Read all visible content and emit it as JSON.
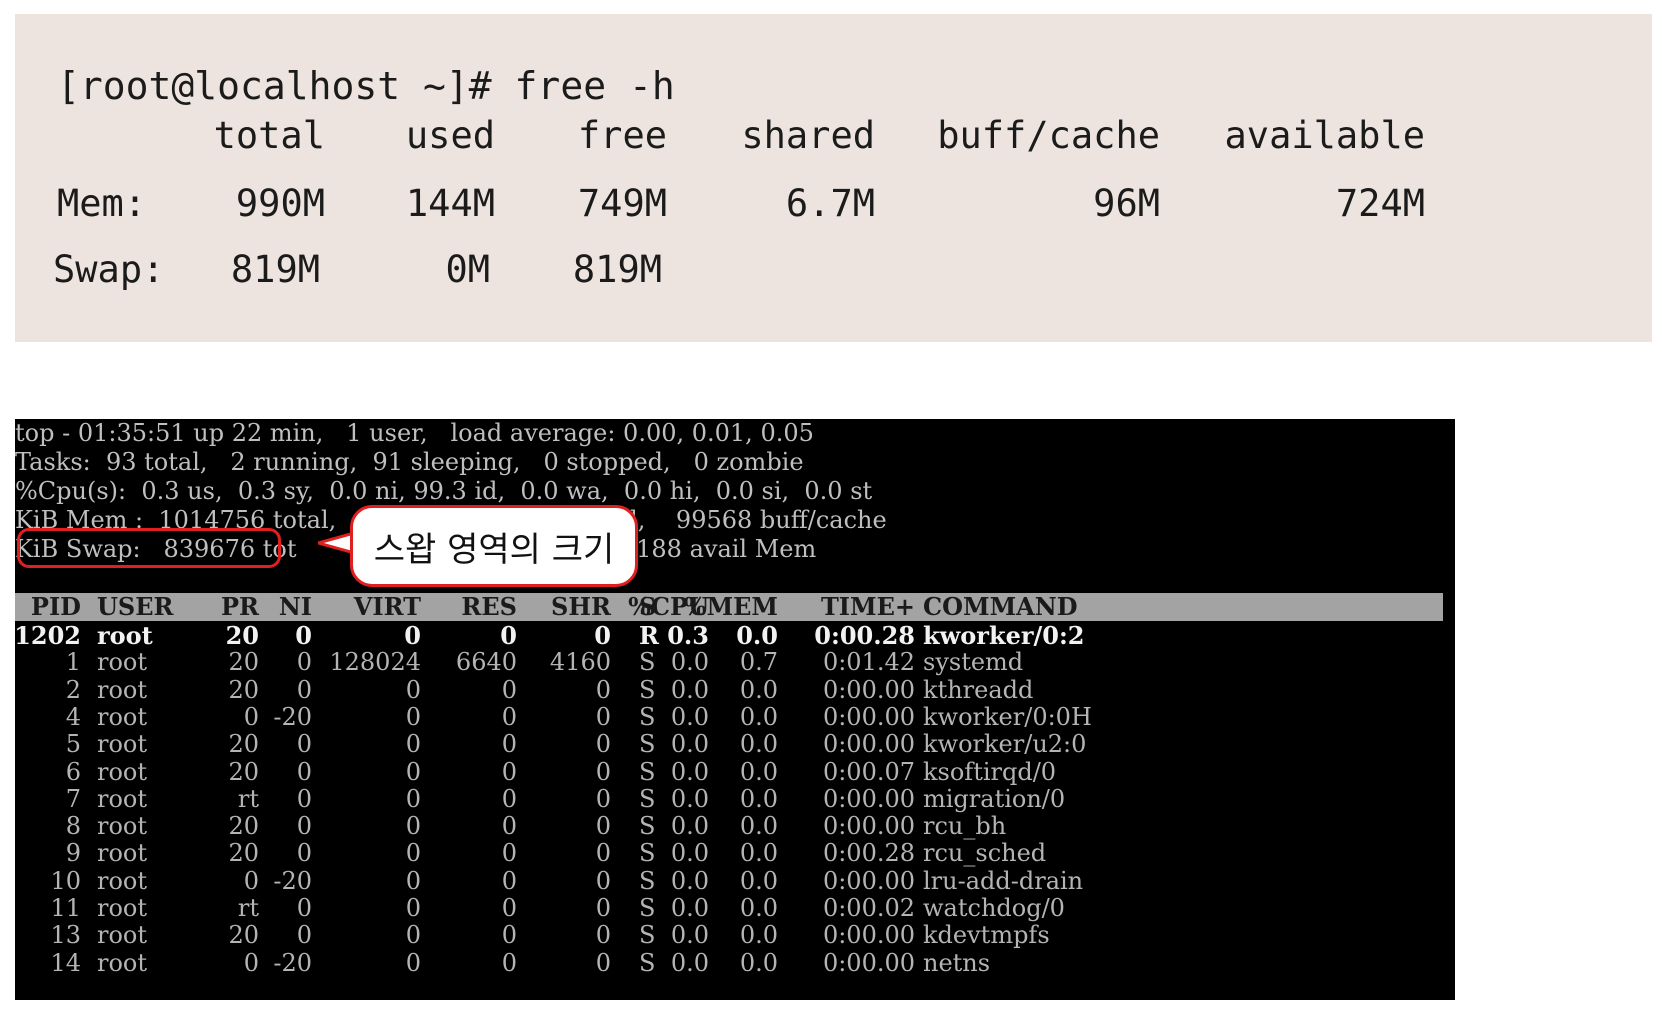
{
  "free": {
    "prompt": "[root@localhost ~]# free -h",
    "headers": [
      "total",
      "used",
      "free",
      "shared",
      "buff/cache",
      "available"
    ],
    "rows": [
      {
        "label": "Mem:",
        "values": [
          "990M",
          "144M",
          "749M",
          "6.7M",
          "96M",
          "724M"
        ]
      },
      {
        "label": "Swap:",
        "values": [
          "819M",
          "0M",
          "819M",
          "",
          "",
          ""
        ]
      }
    ]
  },
  "top": {
    "summary": [
      "top - 01:35:51 up 22 min,   1 user,   load average: 0.00, 0.01, 0.05",
      "Tasks:  93 total,   2 running,  91 sleeping,   0 stopped,   0 zombie",
      "%Cpu(s):  0.3 us,  0.3 sy,  0.0 ni, 99.3 id,  0.0 wa,  0.0 hi,  0.0 si,  0.0 st",
      "KiB Mem :  1014756 total,                   148896 used,    99568 buff/cache",
      "KiB Swap:   839676 tot                        0 used.   741188 avail Mem"
    ],
    "columns": [
      "PID",
      "USER",
      "PR",
      "NI",
      "VIRT",
      "RES",
      "SHR",
      "S",
      "%CPU",
      "%MEM",
      "TIME+",
      "COMMAND"
    ],
    "processes": [
      [
        "1202",
        "root",
        "20",
        "0",
        "0",
        "0",
        "0",
        "R",
        "0.3",
        "0.0",
        "0:00.28",
        "kworker/0:2"
      ],
      [
        "1",
        "root",
        "20",
        "0",
        "128024",
        "6640",
        "4160",
        "S",
        "0.0",
        "0.7",
        "0:01.42",
        "systemd"
      ],
      [
        "2",
        "root",
        "20",
        "0",
        "0",
        "0",
        "0",
        "S",
        "0.0",
        "0.0",
        "0:00.00",
        "kthreadd"
      ],
      [
        "4",
        "root",
        "0",
        "-20",
        "0",
        "0",
        "0",
        "S",
        "0.0",
        "0.0",
        "0:00.00",
        "kworker/0:0H"
      ],
      [
        "5",
        "root",
        "20",
        "0",
        "0",
        "0",
        "0",
        "S",
        "0.0",
        "0.0",
        "0:00.00",
        "kworker/u2:0"
      ],
      [
        "6",
        "root",
        "20",
        "0",
        "0",
        "0",
        "0",
        "S",
        "0.0",
        "0.0",
        "0:00.07",
        "ksoftirqd/0"
      ],
      [
        "7",
        "root",
        "rt",
        "0",
        "0",
        "0",
        "0",
        "S",
        "0.0",
        "0.0",
        "0:00.00",
        "migration/0"
      ],
      [
        "8",
        "root",
        "20",
        "0",
        "0",
        "0",
        "0",
        "S",
        "0.0",
        "0.0",
        "0:00.00",
        "rcu_bh"
      ],
      [
        "9",
        "root",
        "20",
        "0",
        "0",
        "0",
        "0",
        "S",
        "0.0",
        "0.0",
        "0:00.28",
        "rcu_sched"
      ],
      [
        "10",
        "root",
        "0",
        "-20",
        "0",
        "0",
        "0",
        "S",
        "0.0",
        "0.0",
        "0:00.00",
        "lru-add-drain"
      ],
      [
        "11",
        "root",
        "rt",
        "0",
        "0",
        "0",
        "0",
        "S",
        "0.0",
        "0.0",
        "0:00.02",
        "watchdog/0"
      ],
      [
        "13",
        "root",
        "20",
        "0",
        "0",
        "0",
        "0",
        "S",
        "0.0",
        "0.0",
        "0:00.00",
        "kdevtmpfs"
      ],
      [
        "14",
        "root",
        "0",
        "-20",
        "0",
        "0",
        "0",
        "S",
        "0.0",
        "0.0",
        "0:00.00",
        "netns"
      ]
    ]
  },
  "annotation": {
    "callout_text": "스왑 영역의 크기",
    "highlight_color": "#e01f1f"
  }
}
